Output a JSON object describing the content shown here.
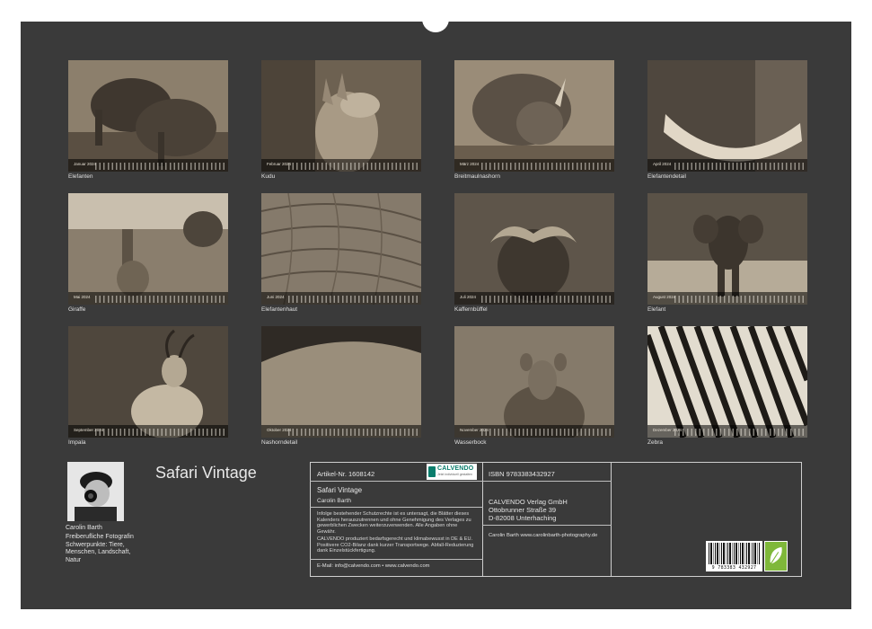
{
  "calendar": {
    "title": "Safari Vintage",
    "year": "2024",
    "months": [
      {
        "month": "Januar",
        "caption": "Elefanten"
      },
      {
        "month": "Februar",
        "caption": "Kudu"
      },
      {
        "month": "März",
        "caption": "Breitmaulnashorn"
      },
      {
        "month": "April",
        "caption": "Elefantendetail"
      },
      {
        "month": "Mai",
        "caption": "Giraffe"
      },
      {
        "month": "Juni",
        "caption": "Elefantenhaut"
      },
      {
        "month": "Juli",
        "caption": "Kaffernbüffel"
      },
      {
        "month": "August",
        "caption": "Elefant"
      },
      {
        "month": "September",
        "caption": "Impala"
      },
      {
        "month": "Oktober",
        "caption": "Nashorndetail"
      },
      {
        "month": "November",
        "caption": "Wasserbock"
      },
      {
        "month": "Dezember",
        "caption": "Zebra"
      }
    ]
  },
  "author": {
    "name": "Carolin Barth",
    "description": "Freiberufliche Fotografin Schwerpunkte: Tiere, Menschen, Landschaft, Natur"
  },
  "product": {
    "article_number": "Artikel-Nr. 1608142",
    "title": "Safari Vintage",
    "author": "Carolin Barth",
    "legal_1": "Infolge bestehender Schutzrechte ist es untersagt, die Blätter dieses Kalenders herauszutrennen und ohne Genehmigung des Verlages zu gewerblichen Zwecken weiterzuverwenden. Alle Angaben ohne Gewähr.",
    "legal_2": "CALVENDO produziert bedarfsgerecht und klimabewusst in DE & EU. Positivere CO2-Bilanz dank kurzer Transportwege. Abfall-Reduzierung dank Einzelstückfertigung.",
    "contact": "E-Mail: info@calvendo.com • www.calvendo.com",
    "isbn": "ISBN 9783383432927",
    "publisher_name": "CALVENDO Verlag GmbH",
    "publisher_street": "Ottobrunner Straße 39",
    "publisher_city": "D-82008 Unterhaching",
    "author_website": "Carolin Barth www.carolinbarth-photography.de",
    "barcode_number": "9 783383 432927"
  },
  "brand": {
    "name": "CALVENDO",
    "tagline": "Jetzt individuell gestalten"
  },
  "colors": {
    "background": "#3a3a3a",
    "text": "#e4e4e4",
    "brand": "#0a7d6c",
    "eco": "#7fb83a"
  }
}
